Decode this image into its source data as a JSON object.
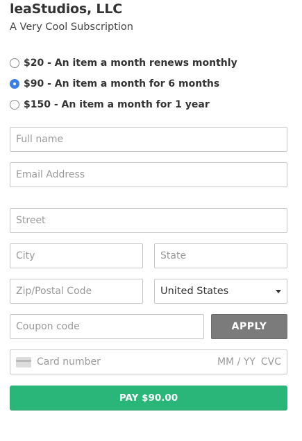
{
  "header": {
    "company": "leaStudios, LLC",
    "subtitle": "A Very Cool Subscription"
  },
  "plans": [
    {
      "label": "$20 - An item a month renews monthly",
      "selected": false
    },
    {
      "label": "$90 - An item a month for 6 months",
      "selected": true
    },
    {
      "label": "$150 - An item a month for 1 year",
      "selected": false
    }
  ],
  "form": {
    "full_name": {
      "placeholder": "Full name",
      "value": ""
    },
    "email": {
      "placeholder": "Email Address",
      "value": ""
    },
    "street": {
      "placeholder": "Street",
      "value": ""
    },
    "city": {
      "placeholder": "City",
      "value": ""
    },
    "state": {
      "placeholder": "State",
      "value": ""
    },
    "zip": {
      "placeholder": "Zip/Postal Code",
      "value": ""
    },
    "country": {
      "value": "United States"
    },
    "coupon": {
      "placeholder": "Coupon code",
      "value": ""
    },
    "apply_label": "APPLY"
  },
  "card": {
    "number_placeholder": "Card number",
    "exp_placeholder": "MM / YY",
    "cvc_placeholder": "CVC"
  },
  "pay_label": "PAY $90.00",
  "colors": {
    "pay_button": "#2bb679",
    "apply_button": "#7b7b7b",
    "radio_selected": "#3b7ee6"
  }
}
